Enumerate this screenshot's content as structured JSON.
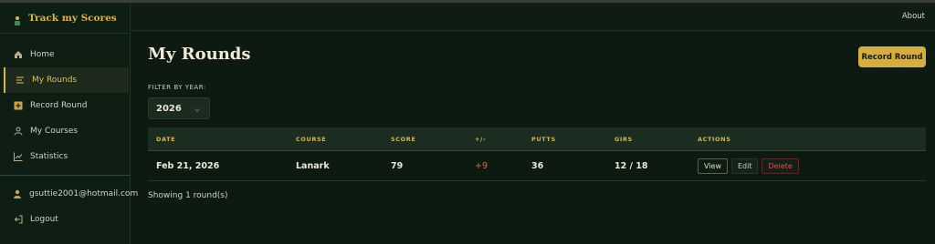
{
  "app": {
    "title": "Track my Scores"
  },
  "topbar": {
    "about_label": "About"
  },
  "sidebar": {
    "items": [
      {
        "label": "Home",
        "icon": "home-icon"
      },
      {
        "label": "My Rounds",
        "icon": "list-icon",
        "active": true
      },
      {
        "label": "Record Round",
        "icon": "plus-square-icon"
      },
      {
        "label": "My Courses",
        "icon": "user-icon"
      },
      {
        "label": "Statistics",
        "icon": "chart-line-icon"
      }
    ],
    "user_email": "gsuttie2001@hotmail.com",
    "logout_label": "Logout"
  },
  "main": {
    "title": "My Rounds",
    "record_button_label": "Record Round",
    "filter_label": "FILTER BY YEAR:",
    "filter_year": "2026"
  },
  "table": {
    "columns": [
      "DATE",
      "COURSE",
      "SCORE",
      "+/-",
      "PUTTS",
      "GIRS",
      "ACTIONS"
    ],
    "rows": [
      {
        "date": "Feb 21, 2026",
        "course": "Lanark",
        "score": "79",
        "diff": "+9",
        "putts": "36",
        "girs": "12 / 18",
        "actions": {
          "view": "View",
          "edit": "Edit",
          "delete": "Delete"
        }
      }
    ]
  },
  "summary": {
    "showing_text": "Showing 1 round(s)"
  },
  "colors": {
    "accent": "#d6ae3d",
    "background": "#0c1a12",
    "danger": "#d3573f",
    "over_par": "#d86b3f"
  }
}
